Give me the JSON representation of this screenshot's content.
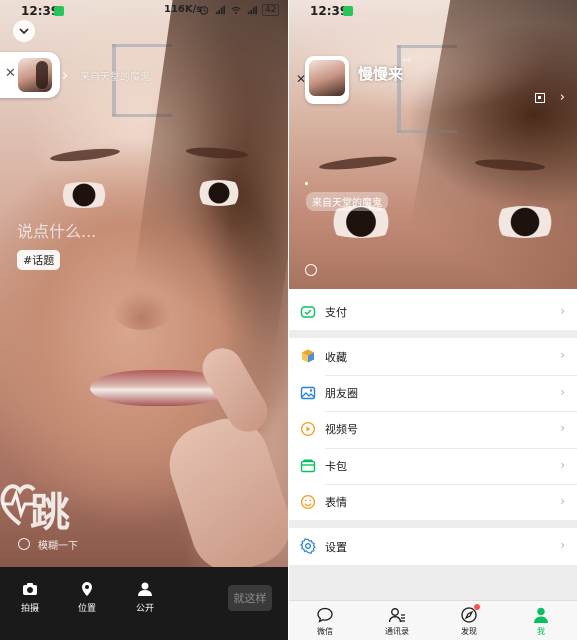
{
  "left": {
    "status_bar": {
      "time": "12:39",
      "speed": "116K/s",
      "battery": "42"
    },
    "mini_card_status_text": "来自天堂的魔鬼",
    "say_placeholder": "说点什么...",
    "topic_chip": "#话题",
    "jump_text": "跳",
    "blur_label": "模糊一下",
    "bottom_bar": {
      "items": [
        {
          "label": "拍摄",
          "icon": "camera-icon"
        },
        {
          "label": "位置",
          "icon": "location-pin-icon"
        },
        {
          "label": "公开",
          "icon": "person-icon"
        }
      ],
      "done_label": "就这样"
    }
  },
  "right": {
    "status_bar": {
      "time": "12:39"
    },
    "profile": {
      "name": "慢慢来",
      "status_text": "来自天堂的魔鬼"
    },
    "menu": [
      [
        {
          "label": "支付",
          "icon": "pay-icon",
          "color": "#07c160"
        }
      ],
      [
        {
          "label": "收藏",
          "icon": "favorites-cube-icon",
          "color": "#f0a429"
        },
        {
          "label": "朋友圈",
          "icon": "moments-photo-icon",
          "color": "#2782d7"
        },
        {
          "label": "视频号",
          "icon": "channels-play-icon",
          "color": "#f0a429"
        },
        {
          "label": "卡包",
          "icon": "card-wallet-icon",
          "color": "#07c160"
        },
        {
          "label": "表情",
          "icon": "emoji-smile-icon",
          "color": "#f0a429"
        }
      ],
      [
        {
          "label": "设置",
          "icon": "settings-gear-icon",
          "color": "#2782d7"
        }
      ]
    ],
    "tabbar": [
      {
        "label": "微信",
        "icon": "chat-bubble-icon",
        "active": false,
        "badge": false
      },
      {
        "label": "通讯录",
        "icon": "contacts-icon",
        "active": false,
        "badge": false
      },
      {
        "label": "发现",
        "icon": "discover-compass-icon",
        "active": false,
        "badge": true
      },
      {
        "label": "我",
        "icon": "me-person-icon",
        "active": true,
        "badge": false
      }
    ],
    "accent": "#07c160"
  }
}
